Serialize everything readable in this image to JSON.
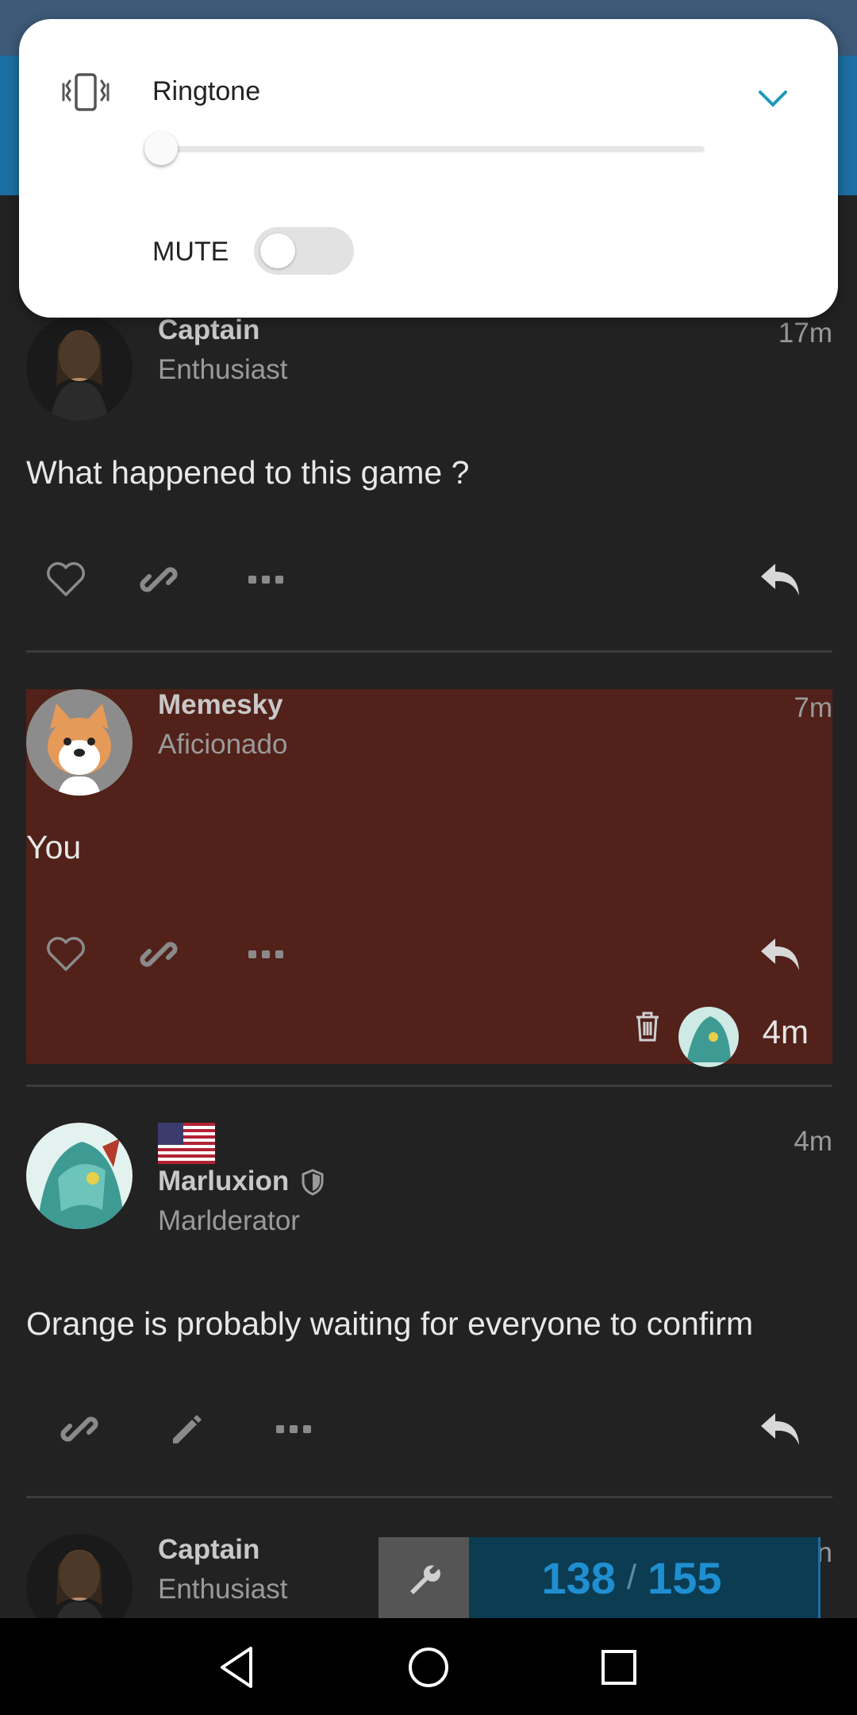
{
  "volume_panel": {
    "title": "Ringtone",
    "mute_label": "MUTE",
    "level": 0,
    "mute_on": false,
    "accent_color": "#1a9ab8"
  },
  "posts": [
    {
      "username": "Captain",
      "user_title": "Enthusiast",
      "time": "17m",
      "body": "What happened to this game ?"
    },
    {
      "username": "Memesky",
      "user_title": "Aficionado",
      "time": "7m",
      "body": "You",
      "reply_time": "4m",
      "highlight_color": "#51211a"
    },
    {
      "username": "Marluxion",
      "user_title": "Marlderator",
      "time": "4m",
      "body": "Orange is probably waiting for everyone to confirm"
    },
    {
      "username": "Captain",
      "user_title": "Enthusiast",
      "time": "n"
    }
  ],
  "progress": {
    "current": "138",
    "separator": "/",
    "total": "155"
  },
  "icons": {
    "volume": "vibrate-icon",
    "chevron": "chevron-down-icon",
    "like": "heart-icon",
    "link": "link-icon",
    "more": "more-icon",
    "reply": "reply-icon",
    "edit": "pencil-icon",
    "delete": "trash-icon",
    "admin": "shield-icon",
    "tools": "wrench-icon"
  }
}
